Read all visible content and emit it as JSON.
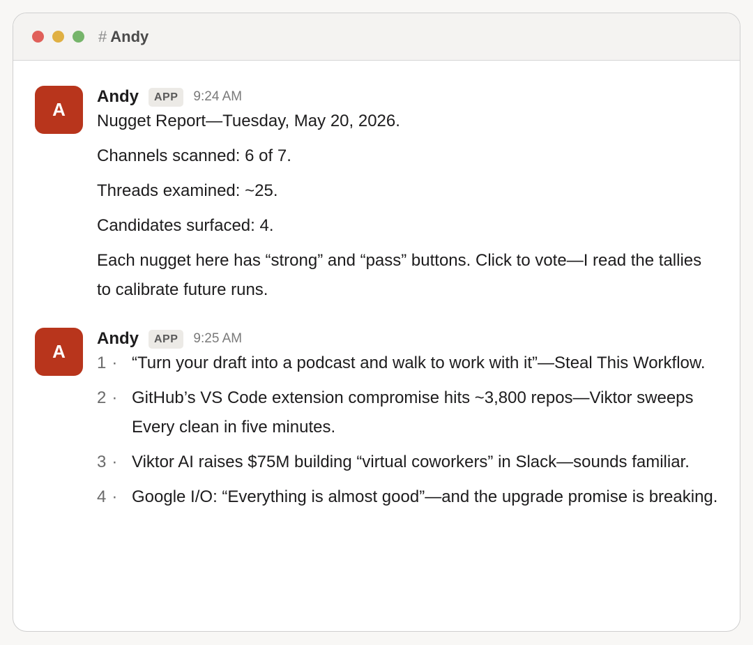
{
  "window": {
    "channel_hash": "#",
    "channel_name": "Andy",
    "traffic_lights": {
      "close": "#e0605a",
      "minimize": "#e0b043",
      "maximize": "#76b56b"
    }
  },
  "messages": [
    {
      "avatar_letter": "A",
      "avatar_color": "#b8351c",
      "author": "Andy",
      "badge": "APP",
      "time": "9:24 AM",
      "paragraphs": [
        "Nugget Report—Tuesday, May 20, 2026.",
        "Channels scanned: 6 of 7.",
        "Threads examined: ~25.",
        "Candidates surfaced: 4.",
        "Each nugget here has “strong” and “pass” buttons. Click to vote—I read the tallies to calibrate future runs."
      ]
    },
    {
      "avatar_letter": "A",
      "avatar_color": "#b8351c",
      "author": "Andy",
      "badge": "APP",
      "time": "9:25 AM",
      "items": [
        {
          "number": "1",
          "separator": "·",
          "text": "“Turn your draft into a podcast and walk to work with it”—Steal This Workflow."
        },
        {
          "number": "2",
          "separator": "·",
          "text": "GitHub’s VS Code extension compromise hits ~3,800 repos—Viktor sweeps Every clean in five minutes."
        },
        {
          "number": "3",
          "separator": "·",
          "text": "Viktor AI raises $75M building “virtual coworkers” in Slack—sounds familiar."
        },
        {
          "number": "4",
          "separator": "·",
          "text": "Google I/O: “Everything is almost good”—and the upgrade promise is breaking."
        }
      ]
    }
  ]
}
